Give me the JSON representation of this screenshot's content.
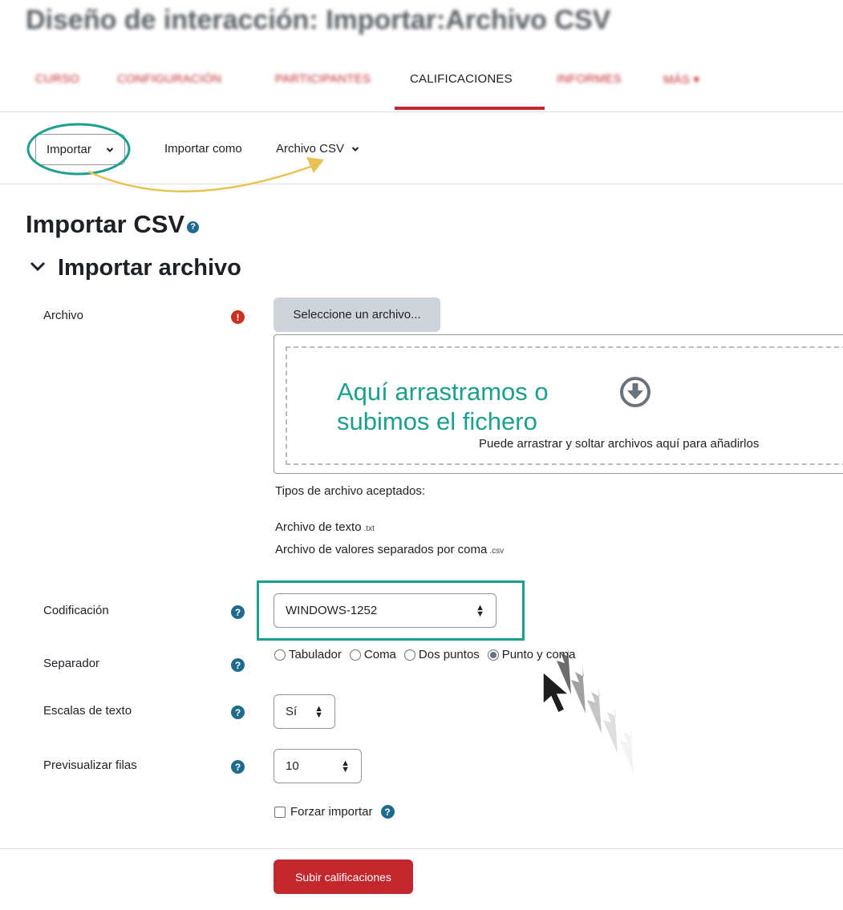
{
  "page": {
    "title": "Diseño de interacción: Importar:Archivo CSV"
  },
  "tabs": [
    {
      "label": "Curso"
    },
    {
      "label": "Configuración"
    },
    {
      "label": "Participantes"
    },
    {
      "label": "Calificaciones"
    },
    {
      "label": "Informes"
    },
    {
      "label": "Más ▾"
    }
  ],
  "tertiary": {
    "action_select": "Importar",
    "import_as_label": "Importar como",
    "import_as_value": "Archivo CSV"
  },
  "heading": "Importar CSV",
  "section": "Importar archivo",
  "form": {
    "file": {
      "label": "Archivo",
      "button": "Seleccione un archivo...",
      "annotation": "Aquí arrastramos o\nsubimos el fichero",
      "dropzone_hint": "Puede arrastrar y soltar archivos aquí para añadirlos",
      "accepted_title": "Tipos de archivo aceptados:",
      "accepted": [
        {
          "name": "Archivo de texto",
          "ext": ".txt"
        },
        {
          "name": "Archivo de valores separados por coma",
          "ext": ".csv"
        }
      ]
    },
    "encoding": {
      "label": "Codificación",
      "value": "WINDOWS-1252"
    },
    "separator": {
      "label": "Separador",
      "options": [
        "Tabulador",
        "Coma",
        "Dos puntos",
        "Punto y coma"
      ],
      "selected": "Punto y coma"
    },
    "text_scales": {
      "label": "Escalas de texto",
      "value": "Sí"
    },
    "preview_rows": {
      "label": "Previsualizar filas",
      "value": "10"
    },
    "force_import": {
      "label": "Forzar importar"
    },
    "submit": "Subir calificaciones"
  },
  "colors": {
    "brand": "#c2272d",
    "annotation_teal": "#1aa08c",
    "annotation_arrow": "#e8c253",
    "help_icon": "#1f6b8d",
    "required_icon": "#ca3120"
  },
  "icons": {
    "required": "exclamation-circle-icon",
    "help": "question-circle-icon",
    "dropzone": "download-circle-icon"
  }
}
